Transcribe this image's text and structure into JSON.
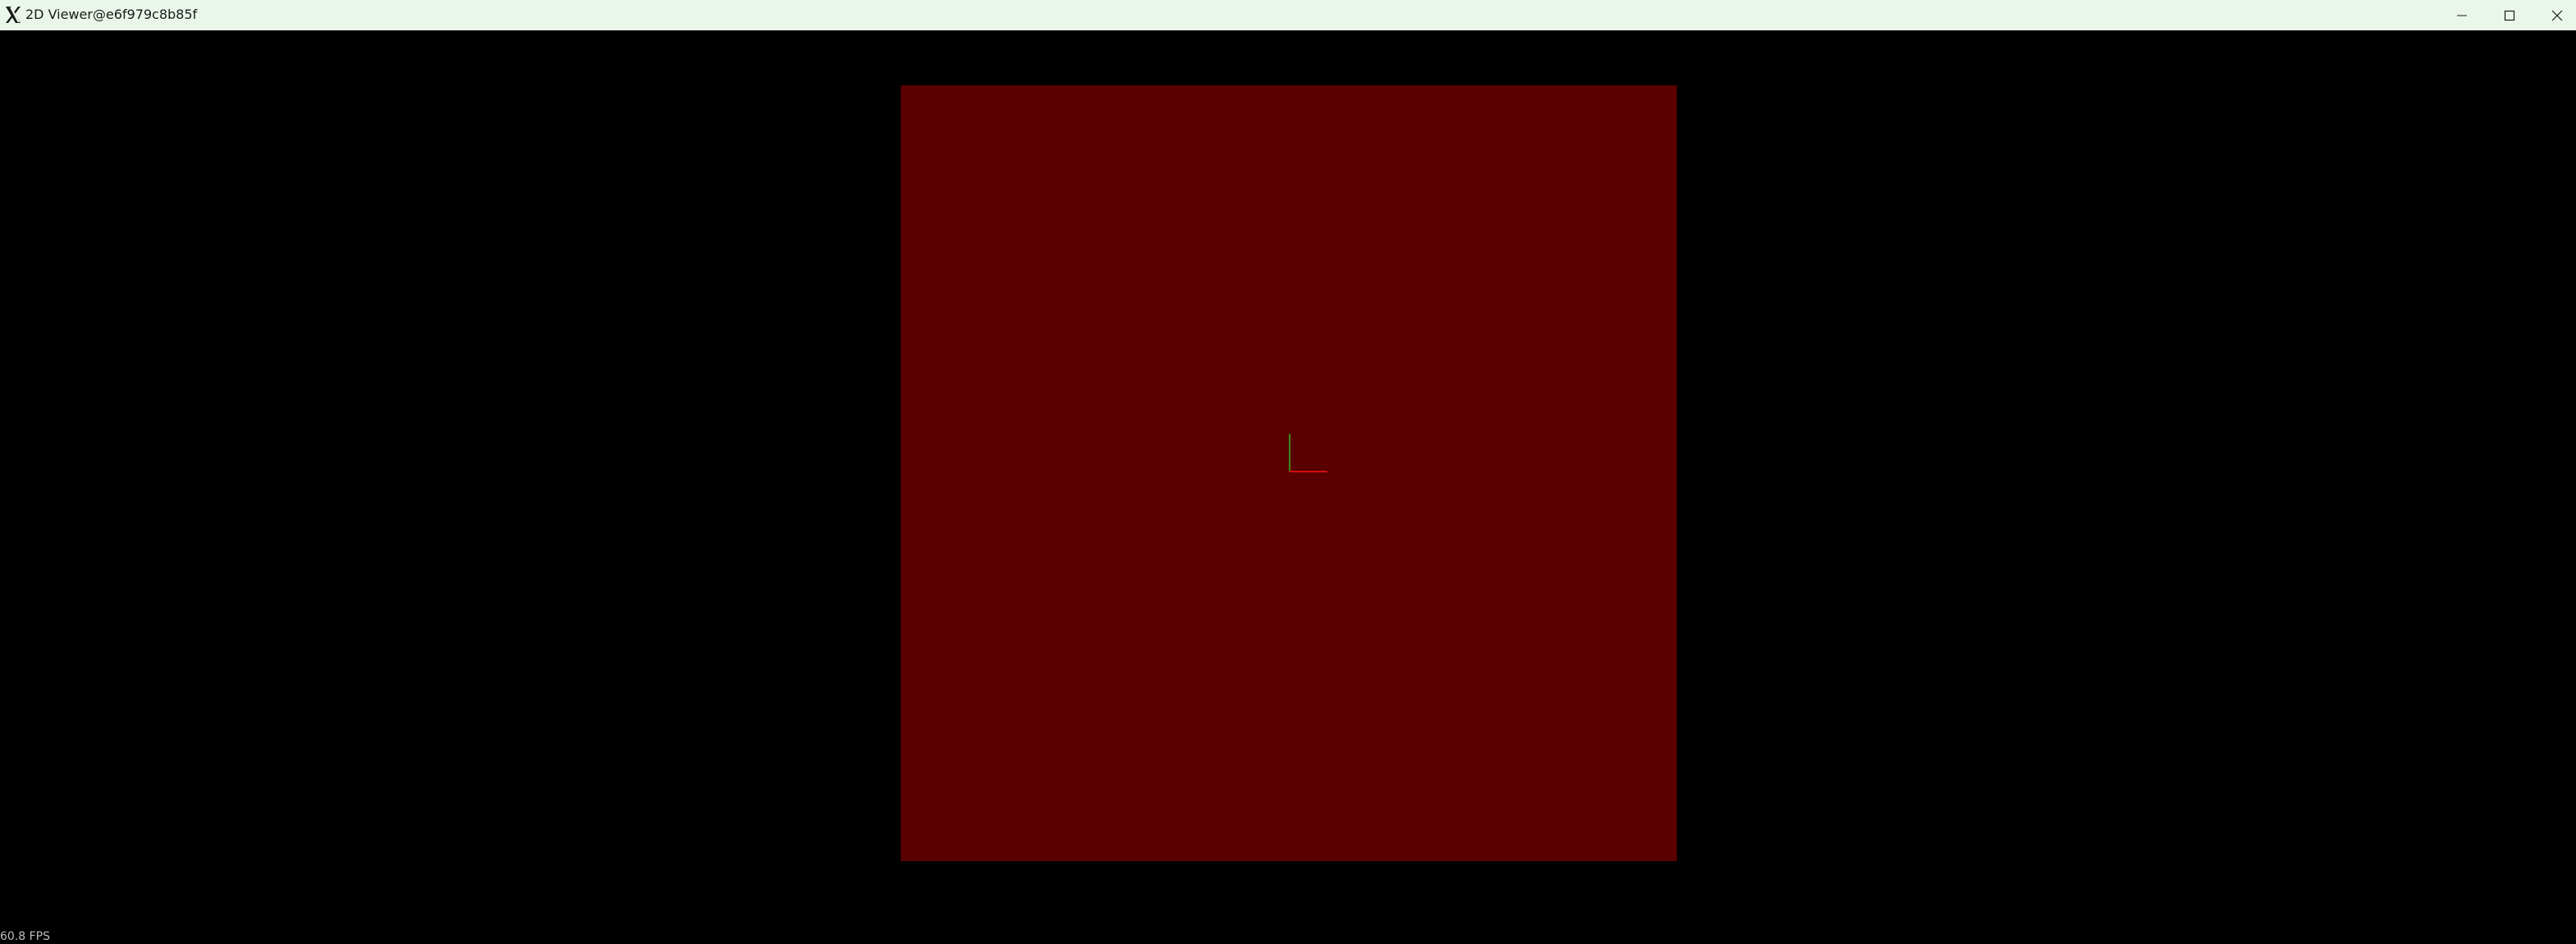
{
  "window": {
    "title": "2D Viewer@e6f979c8b85f",
    "app_icon": "x-logo-icon",
    "controls": {
      "minimize_icon": "minimize-icon",
      "maximize_icon": "maximize-icon",
      "close_icon": "close-icon"
    }
  },
  "viewport": {
    "background_color": "#000000",
    "plane_color": "#5a0000",
    "axes": {
      "x_axis_color": "#d01010",
      "y_axis_color": "#3a8a1a"
    }
  },
  "status": {
    "fps": "60.8 FPS"
  }
}
